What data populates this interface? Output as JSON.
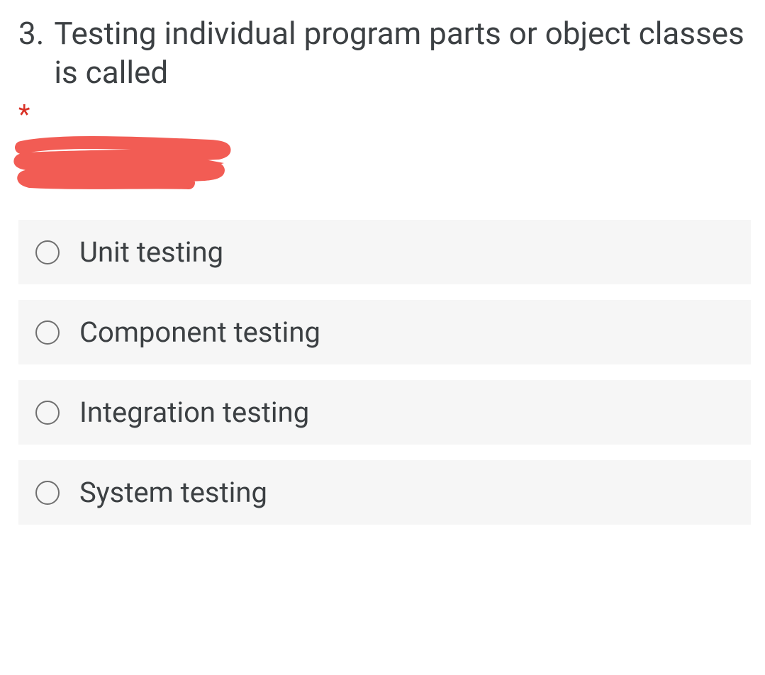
{
  "question": {
    "number": "3.",
    "text": "Testing individual program parts or object classes is called",
    "required_marker": "*"
  },
  "options": [
    {
      "label": "Unit testing"
    },
    {
      "label": "Component testing"
    },
    {
      "label": "Integration testing"
    },
    {
      "label": "System testing"
    }
  ]
}
